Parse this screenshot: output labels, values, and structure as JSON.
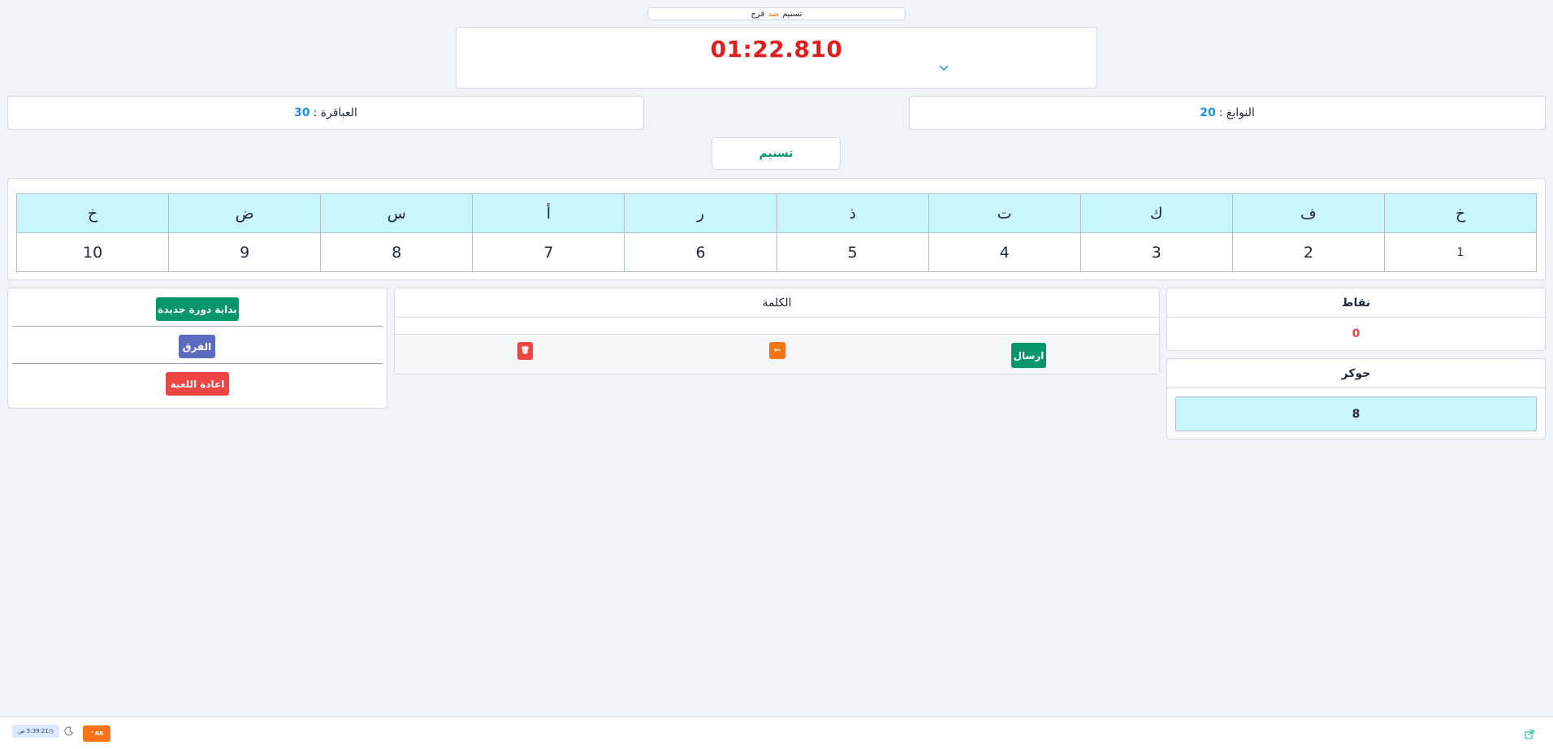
{
  "match": {
    "team_a": "تسنيم",
    "vs": "ضد",
    "team_b": "فرج"
  },
  "timer": {
    "value": "01:22.810"
  },
  "teams": {
    "right": {
      "label": "النوابغ :",
      "score": "20"
    },
    "left": {
      "label": "العباقرة :",
      "score": "30"
    }
  },
  "active_team": "تسنيم",
  "grid": {
    "letters": [
      "خ",
      "ف",
      "ك",
      "ت",
      "ذ",
      "ر",
      "أ",
      "س",
      "ض",
      "خ"
    ],
    "numbers": [
      "1",
      "2",
      "3",
      "4",
      "5",
      "6",
      "7",
      "8",
      "9",
      "10"
    ]
  },
  "points": {
    "title": "نقاط",
    "value": "0"
  },
  "joker": {
    "title": "جوكر",
    "value": "8"
  },
  "word": {
    "title": "الكلمة",
    "send_label": "ارسال",
    "back_label": "←",
    "clear_label": "🗑"
  },
  "controls": {
    "new_round": "بداية دورة جديدة",
    "teams": "الفرق",
    "restart": "اعادة اللعبة"
  },
  "footer": {
    "clock": "5:39:21 ص",
    "lang": "AR"
  },
  "colors": {
    "timer": "#e11d1d",
    "score": "#1d8fe0",
    "green": "#059669",
    "orange": "#f97316",
    "red": "#ef4444",
    "indigo": "#5c6bc0",
    "cell": "#c9f6fd"
  },
  "icons": [
    "chevron-down-icon",
    "moon-icon",
    "external-link-icon",
    "clock-icon"
  ]
}
